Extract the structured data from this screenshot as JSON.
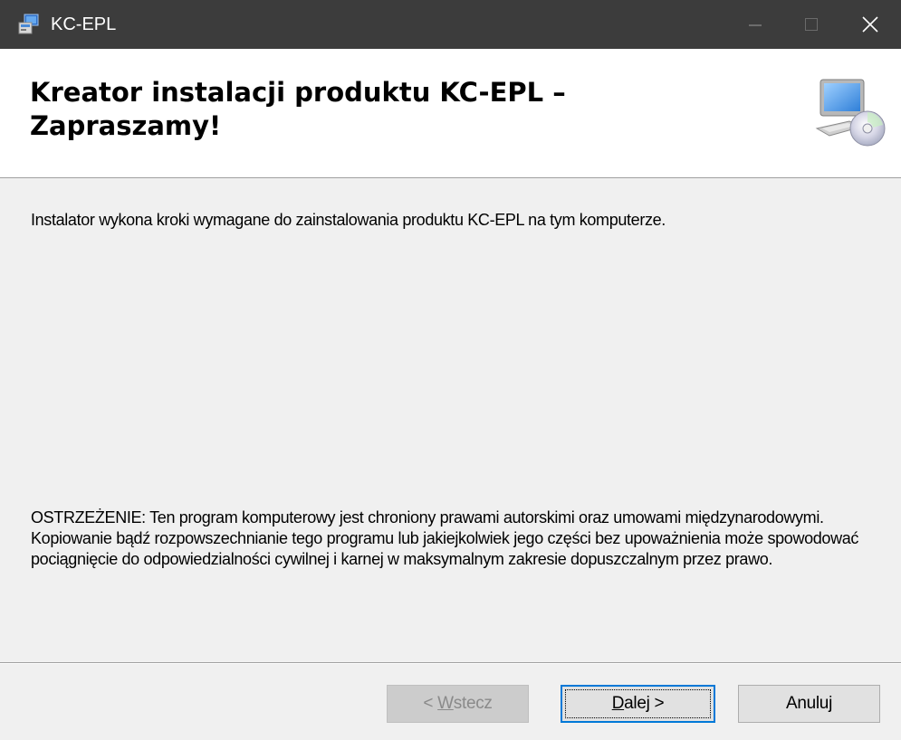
{
  "window": {
    "title": "KC-EPL",
    "minimize_icon": "minimize-icon",
    "maximize_icon": "maximize-icon",
    "close_icon": "close-icon"
  },
  "header": {
    "title": "Kreator instalacji produktu KC-EPL – Zapraszamy!",
    "icon": "computer-cd-icon"
  },
  "content": {
    "intro": "Instalator wykona kroki wymagane do zainstalowania produktu KC-EPL na tym komputerze.",
    "warning": "OSTRZEŻENIE: Ten program komputerowy jest chroniony prawami autorskimi oraz umowami międzynarodowymi. Kopiowanie bądź rozpowszechnianie tego programu lub jakiejkolwiek jego części bez upoważnienia może spowodować pociągnięcie do odpowiedzialności cywilnej i karnej w maksymalnym zakresie dopuszczalnym przez prawo."
  },
  "buttons": {
    "back": {
      "prefix": "< ",
      "accel": "W",
      "rest": "stecz",
      "enabled": false
    },
    "next": {
      "accel": "D",
      "rest": "alej >"
    },
    "cancel": "Anuluj"
  }
}
